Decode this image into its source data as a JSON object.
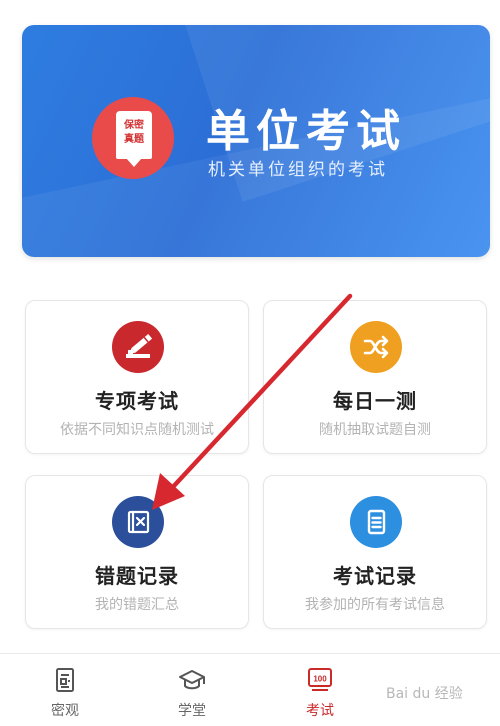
{
  "banner": {
    "title": "单位考试",
    "subtitle": "机关单位组织的考试",
    "badge_text": "保密\n真题"
  },
  "cards": [
    {
      "title": "专项考试",
      "desc": "依据不同知识点随机测试",
      "icon": "pencil-icon",
      "color": "#c9282d"
    },
    {
      "title": "每日一测",
      "desc": "随机抽取试题自测",
      "icon": "shuffle-icon",
      "color": "#f0a020"
    },
    {
      "title": "错题记录",
      "desc": "我的错题汇总",
      "icon": "wrong-book-icon",
      "color": "#2b4f9b"
    },
    {
      "title": "考试记录",
      "desc": "我参加的所有考试信息",
      "icon": "document-icon",
      "color": "#2d8fe0"
    }
  ],
  "tabs": [
    {
      "label": "密观",
      "icon": "document-icon",
      "active": false
    },
    {
      "label": "学堂",
      "icon": "graduation-cap-icon",
      "active": false
    },
    {
      "label": "考试",
      "icon": "exam-100-icon",
      "active": true
    }
  ],
  "exam_icon_text": "100",
  "watermark": "Bai du 经验",
  "colors": {
    "accent": "#c92a2a",
    "banner": "#2f7de0",
    "arrow": "#d7282f"
  }
}
